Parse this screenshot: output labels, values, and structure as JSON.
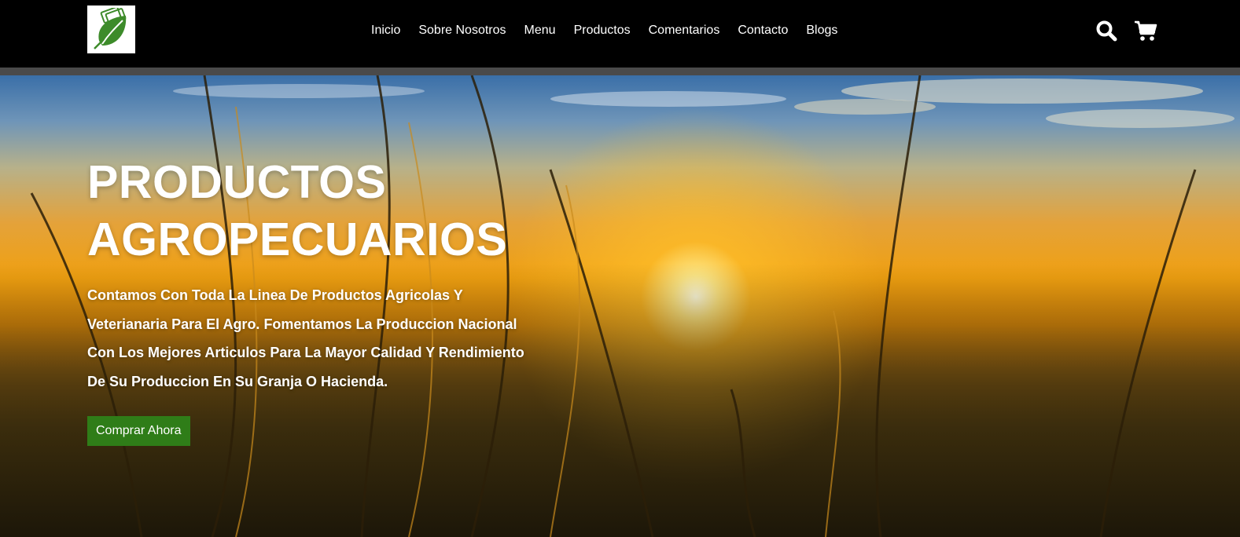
{
  "nav": {
    "logo_icon": "leaf-money-logo",
    "links": [
      "Inicio",
      "Sobre Nosotros",
      "Menu",
      "Productos",
      "Comentarios",
      "Contacto",
      "Blogs"
    ],
    "icons": [
      "search-icon",
      "cart-icon"
    ]
  },
  "hero": {
    "title_line1": "PRODUCTOS",
    "title_line2": "AGROPECUARIOS",
    "desc_line1": "Contamos Con Toda La Linea De Productos Agricolas Y",
    "desc_line2": "Veterianaria Para El Agro. Fomentamos La Produccion Nacional",
    "desc_line3": "Con Los Mejores Articulos Para La Mayor Calidad Y Rendimiento",
    "desc_line4": "De Su Produccion En Su Granja O Hacienda.",
    "cta_label": "Comprar Ahora"
  },
  "colors": {
    "nav_bg": "#000000",
    "cta_bg": "#2f7d18",
    "logo_green": "#3d8b2a"
  }
}
